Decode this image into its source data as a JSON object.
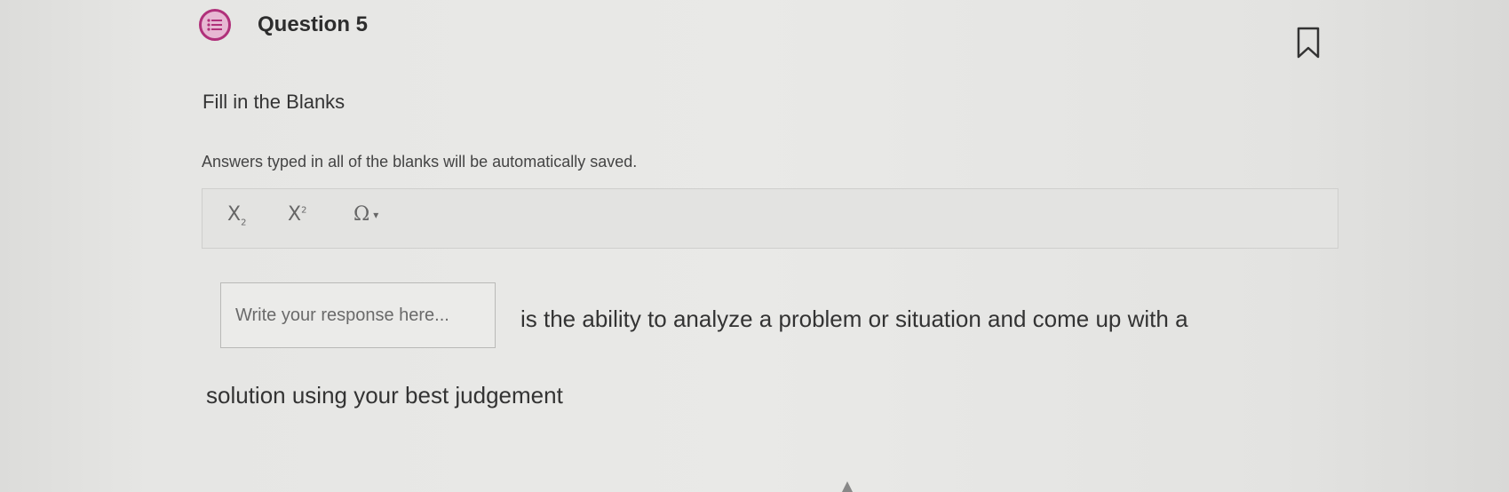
{
  "question": {
    "title": "Question 5",
    "icon": "question-list-icon",
    "icon_color": "#b0307a",
    "bookmark_icon": "bookmark-icon"
  },
  "section": {
    "title": "Fill in the Blanks",
    "instructions": "Answers typed in all of the blanks will be automatically saved."
  },
  "toolbar": {
    "subscript_label": "X",
    "subscript_mark": "2",
    "superscript_label": "X",
    "superscript_mark": "2",
    "special_chars_label": "Ω",
    "special_chars_caret": "▾"
  },
  "blank": {
    "placeholder": "Write your response here...",
    "value": ""
  },
  "sentence": {
    "part_after_blank_line1": "is the ability to analyze a problem or situation and come up with a",
    "part_after_blank_line2": "solution using your best judgement"
  }
}
